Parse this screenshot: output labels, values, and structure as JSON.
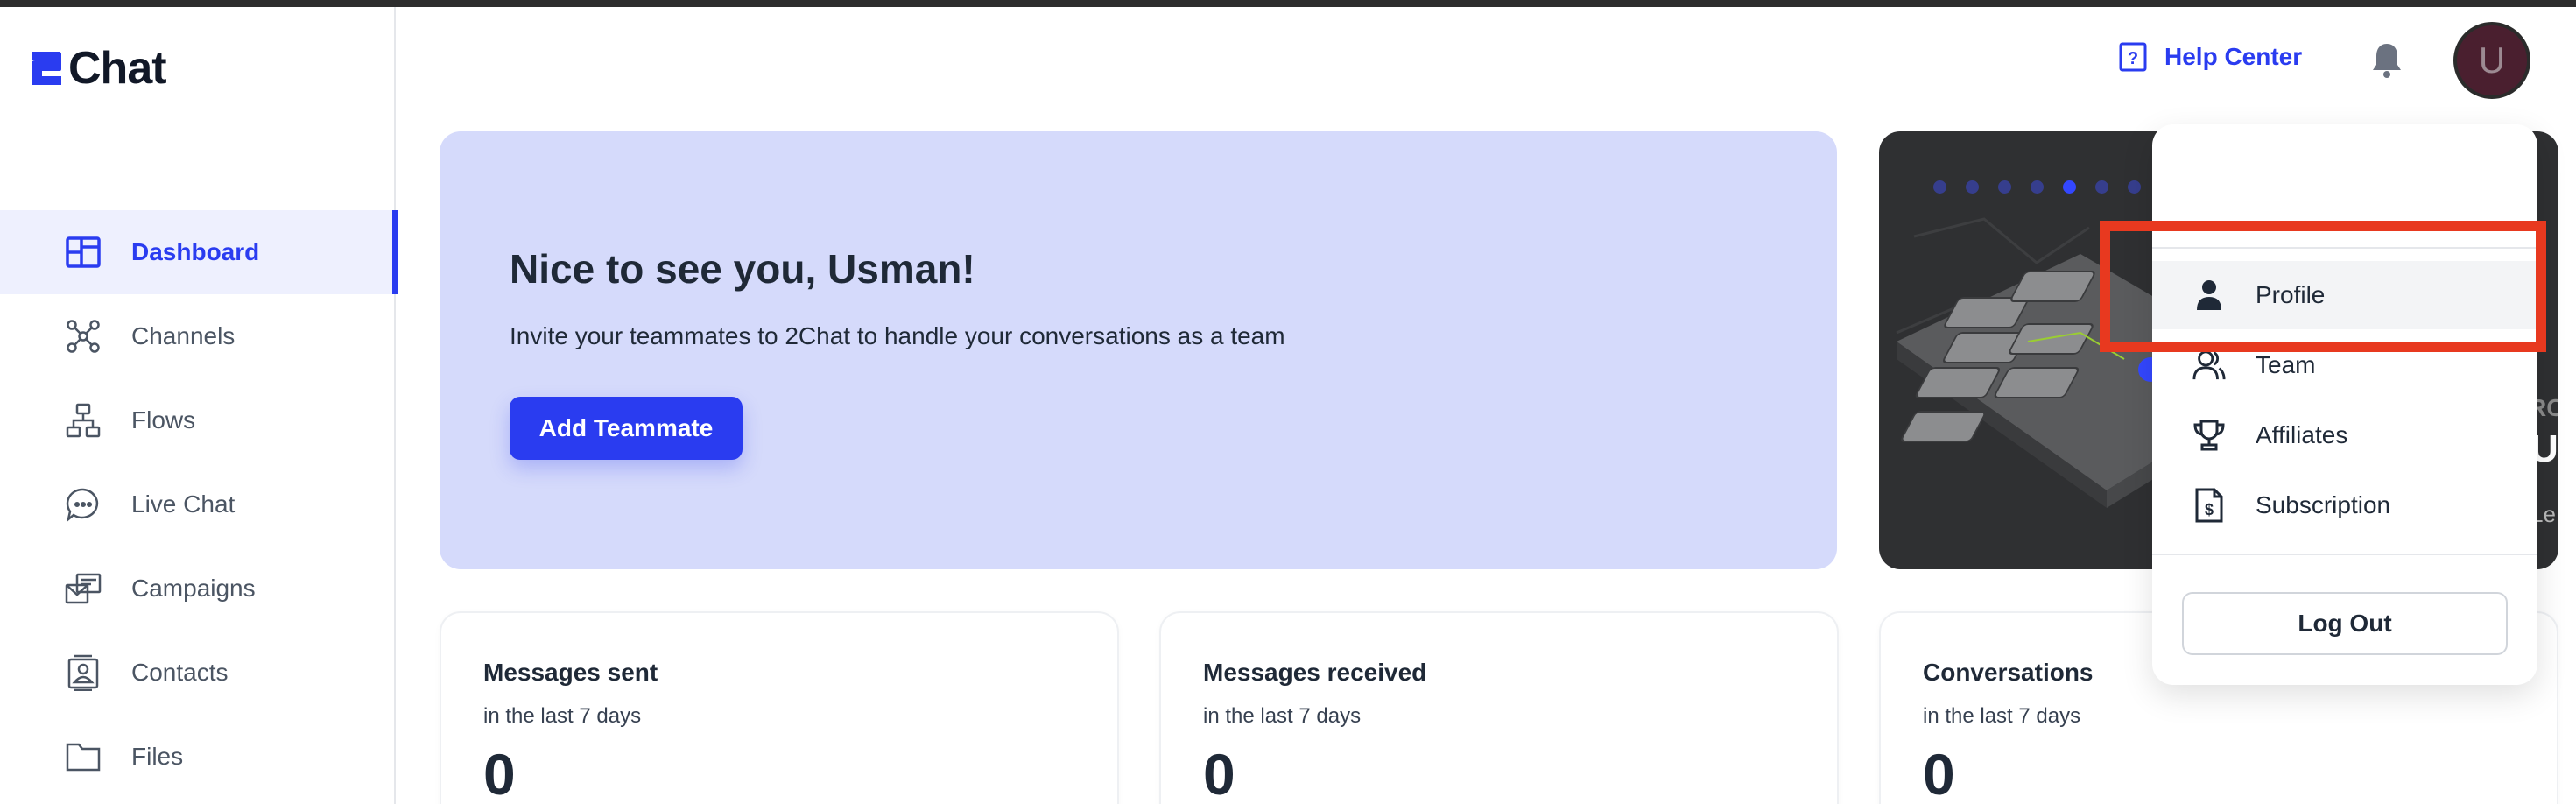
{
  "app": {
    "logo_text": "Chat"
  },
  "colors": {
    "accent": "#2a3cf0",
    "highlight": "#e8391f",
    "welcome_bg": "#d5dafb"
  },
  "sidebar": {
    "items": [
      {
        "label": "Dashboard",
        "icon": "dashboard-icon",
        "active": true
      },
      {
        "label": "Channels",
        "icon": "channels-icon"
      },
      {
        "label": "Flows",
        "icon": "flows-icon"
      },
      {
        "label": "Live Chat",
        "icon": "chat-bubble-icon"
      },
      {
        "label": "Campaigns",
        "icon": "campaigns-icon"
      },
      {
        "label": "Contacts",
        "icon": "contacts-icon"
      },
      {
        "label": "Files",
        "icon": "folder-icon"
      }
    ]
  },
  "header": {
    "help_label": "Help Center",
    "avatar_initial": "U"
  },
  "welcome": {
    "title": "Nice to see you, Usman!",
    "subtitle": "Invite your teammates to 2Chat to handle your conversations as a team",
    "button_label": "Add Teammate"
  },
  "promo": {
    "dot_count": 7,
    "active_dot": 4,
    "edge_text_1": "RC",
    "edge_text_2": "Us",
    "edge_text_3": "Le"
  },
  "stats": [
    {
      "title": "Messages sent",
      "period": "in the last 7 days",
      "value": "0"
    },
    {
      "title": "Messages received",
      "period": "in the last 7 days",
      "value": "0"
    },
    {
      "title": "Conversations",
      "period": "in the last 7 days",
      "value": "0"
    }
  ],
  "user_menu": {
    "items": [
      {
        "label": "Profile",
        "icon": "person-icon"
      },
      {
        "label": "Team",
        "icon": "team-icon"
      },
      {
        "label": "Affiliates",
        "icon": "trophy-icon"
      },
      {
        "label": "Subscription",
        "icon": "invoice-icon"
      }
    ],
    "logout_label": "Log Out"
  }
}
